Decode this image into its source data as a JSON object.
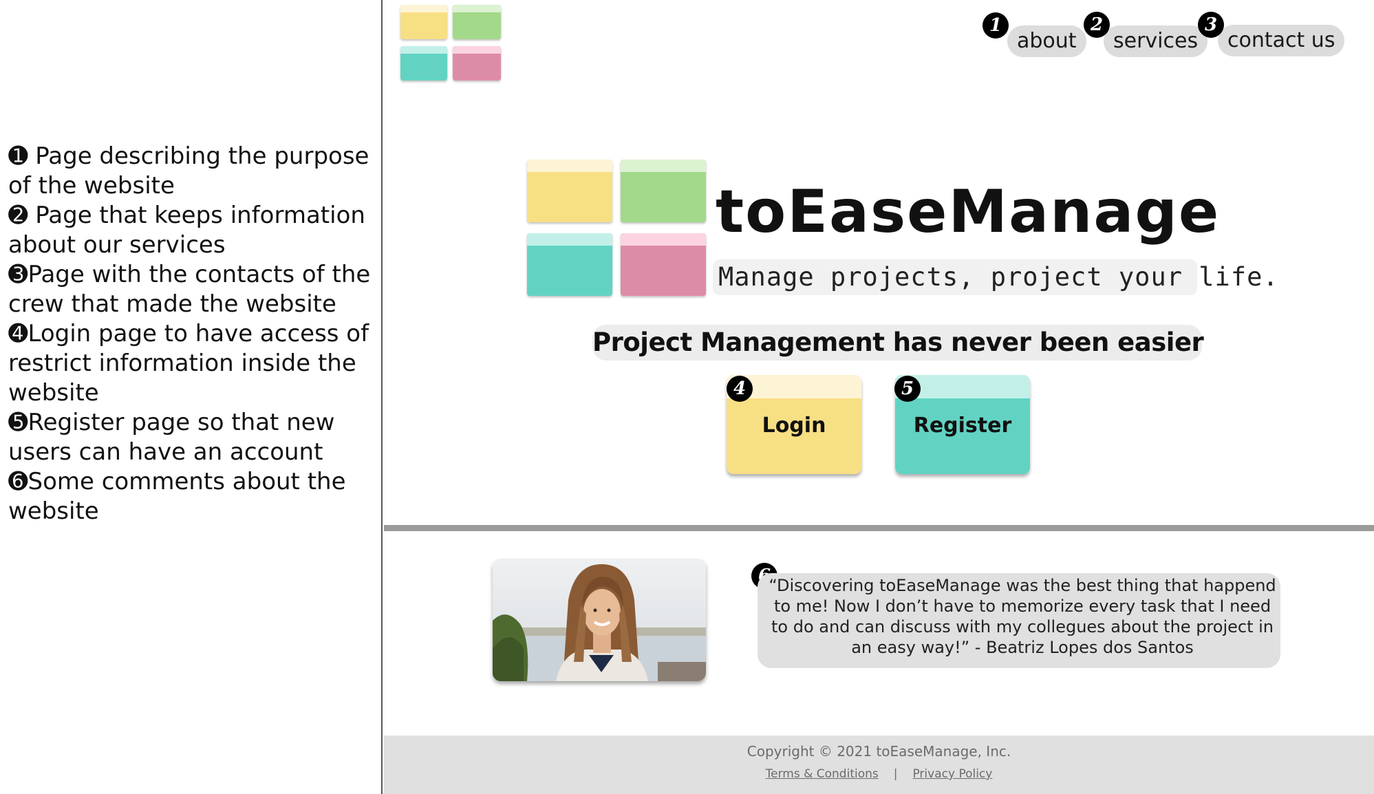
{
  "annotations": [
    {
      "bullet": "➊",
      "text": " Page describing the purpose of the website"
    },
    {
      "bullet": "➋",
      "text": " Page that keeps information about our services"
    },
    {
      "bullet": "➌",
      "text": "Page with the contacts of the crew that made the website"
    },
    {
      "bullet": "➍",
      "text": "Login page to have access of restrict information inside the website"
    },
    {
      "bullet": "➎",
      "text": "Register page so that new users can have an account"
    },
    {
      "bullet": "➏",
      "text": "Some comments about the website"
    }
  ],
  "nav": [
    {
      "number": "1",
      "label": "about"
    },
    {
      "number": "2",
      "label": "services"
    },
    {
      "number": "3",
      "label": "contact us"
    }
  ],
  "brand": {
    "name": "toEaseManage",
    "slogan": "Manage projects, project your life."
  },
  "headline": "Project Management has never been easier",
  "buttons": {
    "login": {
      "number": "4",
      "label": "Login"
    },
    "register": {
      "number": "5",
      "label": "Register"
    }
  },
  "testimonial": {
    "number": "6",
    "quote": "“Discovering toEaseManage was the best thing that happend to me! Now I don’t have to memorize every task that I need to do and can discuss with my collegues about the project in an easy way!” - Beatriz Lopes dos Santos"
  },
  "footer": {
    "copyright": "Copyright © 2021 toEaseManage, Inc.",
    "terms": "Terms & Conditions",
    "separator": "|",
    "privacy": "Privacy Policy"
  },
  "colors": {
    "yellow": "#f7df84",
    "yellow_light": "#fdf4d6",
    "green": "#a3d98a",
    "green_light": "#dcf2d0",
    "teal": "#62d3c3",
    "teal_light": "#c2f0e8",
    "pink": "#dd8ca8",
    "pink_light": "#fbd3e1",
    "divider": "#9b9b9b",
    "footer_bg": "#e0e0e0"
  }
}
